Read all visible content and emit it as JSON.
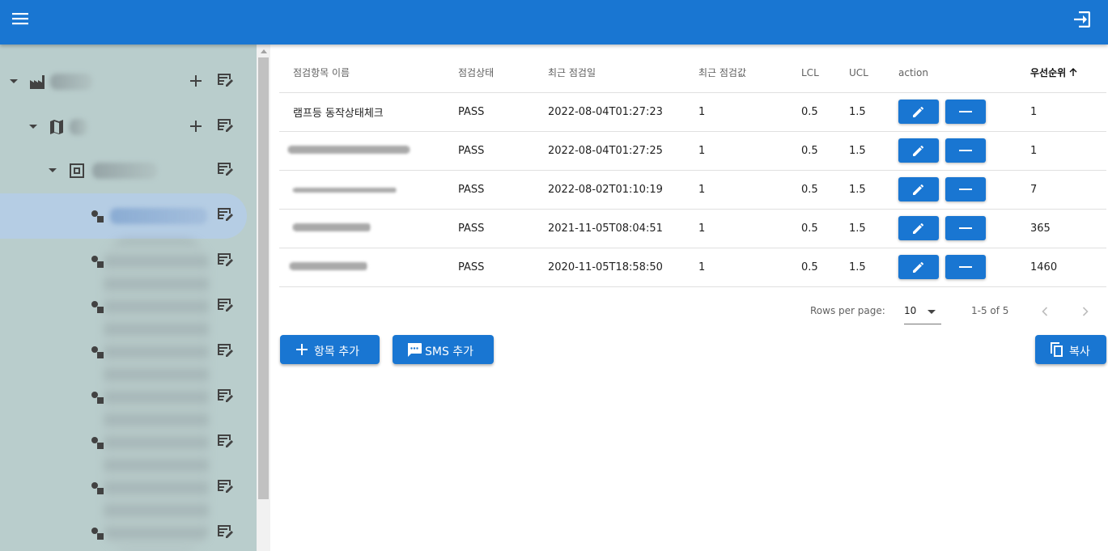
{
  "appbar": {
    "menu_icon": "hamburger-menu-icon",
    "logout_icon": "logout-icon",
    "color": "#1976d2"
  },
  "sidebar": {
    "background": "#b9cdcc",
    "tree_icons": [
      "factory-icon",
      "map-icon",
      "floorplan-icon",
      "sensor-node-icon"
    ]
  },
  "table": {
    "headers": {
      "name": "점검항목 이름",
      "status": "점검상태",
      "last_date": "최근 점검일",
      "last_value": "최근 점검값",
      "lcl": "LCL",
      "ucl": "UCL",
      "action": "action",
      "priority": "우선순위"
    },
    "sort_icon": "arrow-up-icon",
    "rows": [
      {
        "name": "램프등 동작상태체크",
        "status": "PASS",
        "last_date": "2022-08-04T01:27:23",
        "last_value": "1",
        "lcl": "0.5",
        "ucl": "1.5",
        "priority": "1"
      },
      {
        "name": "",
        "status": "PASS",
        "last_date": "2022-08-04T01:27:25",
        "last_value": "1",
        "lcl": "0.5",
        "ucl": "1.5",
        "priority": "1"
      },
      {
        "name": "",
        "status": "PASS",
        "last_date": "2022-08-02T01:10:19",
        "last_value": "1",
        "lcl": "0.5",
        "ucl": "1.5",
        "priority": "7"
      },
      {
        "name": "",
        "status": "PASS",
        "last_date": "2021-11-05T08:04:51",
        "last_value": "1",
        "lcl": "0.5",
        "ucl": "1.5",
        "priority": "365"
      },
      {
        "name": "",
        "status": "PASS",
        "last_date": "2020-11-05T18:58:50",
        "last_value": "1",
        "lcl": "0.5",
        "ucl": "1.5",
        "priority": "1460"
      }
    ]
  },
  "pagination": {
    "rows_per_page_label": "Rows per page:",
    "rows_per_page_value": "10",
    "range": "1-5 of 5"
  },
  "buttons": {
    "add_item": "항목 추가",
    "add_sms": "SMS 추가",
    "copy": "복사"
  }
}
